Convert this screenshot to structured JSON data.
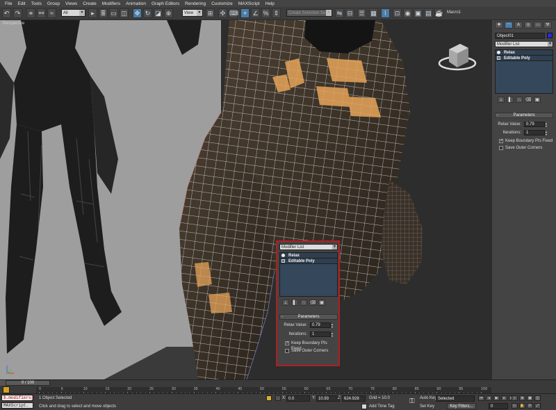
{
  "menu": [
    "File",
    "Edit",
    "Tools",
    "Group",
    "Views",
    "Create",
    "Modifiers",
    "Animation",
    "Graph Editors",
    "Rendering",
    "Customize",
    "MAXScript",
    "Help"
  ],
  "toolbar": {
    "selection_filter": "All",
    "ref_coord": "View",
    "named_selection_placeholder": "Create Selection Se",
    "macro_label": "Macro1"
  },
  "viewport": {
    "label": "Perspective"
  },
  "command_panel": {
    "object_name": "Object01",
    "object_color": "#2b2bd6",
    "modifier_list_label": "Modifier List",
    "stack": [
      {
        "name": "Relax",
        "type": "modifier"
      },
      {
        "name": "Editable Poly",
        "type": "base"
      }
    ],
    "rollout_title": "Parameters",
    "params": {
      "relax_value_label": "Relax Value:",
      "relax_value": "0.79",
      "iterations_label": "Iterations:",
      "iterations": "1",
      "keep_boundary_label": "Keep Boundary Pts Fixed",
      "keep_boundary_checked": true,
      "save_outer_label": "Save Outer Corners",
      "save_outer_checked": false
    }
  },
  "timeline": {
    "frame_display": "0 / 100",
    "ticks": [
      "0",
      "5",
      "10",
      "15",
      "20",
      "25",
      "30",
      "35",
      "40",
      "45",
      "50",
      "55",
      "60",
      "65",
      "70",
      "75",
      "80",
      "85",
      "90",
      "95",
      "100"
    ]
  },
  "status": {
    "listener_line1": "$.modifiers[",
    "listener_line2": "MAXScript.",
    "selection_status": "1 Object Selected",
    "prompt": "Click and drag to select and move objects",
    "x_label": "X:",
    "x_value": "0.0",
    "y_label": "Y:",
    "y_value": "10.93",
    "z_label": "Z:",
    "z_value": "624.928",
    "grid": "Grid = 10.0",
    "add_time_tag": "Add Time Tag",
    "auto_key": "Auto Key",
    "set_key": "Set Key",
    "selected": "Selected",
    "key_filters": "Key Filters...",
    "frame": "0"
  }
}
